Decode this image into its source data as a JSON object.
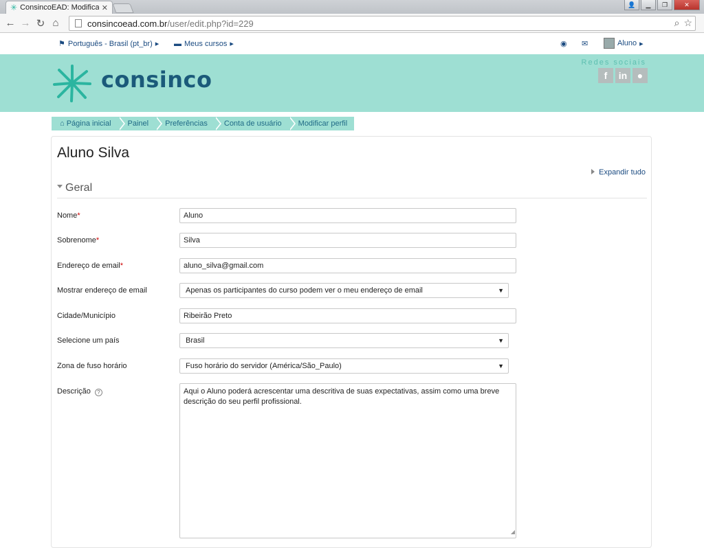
{
  "browser": {
    "tab_title": "ConsincoEAD: Modificar p",
    "tab_close": "✕",
    "url_host": "consincoead.com.br",
    "url_path": "/user/edit.php?id=229"
  },
  "topnav": {
    "language": "Português - Brasil (pt_br)",
    "my_courses": "Meus cursos",
    "user": "Aluno"
  },
  "header": {
    "logo_text": "consinco",
    "social_title": "Redes sociais",
    "social": [
      "f",
      "in",
      "●"
    ]
  },
  "breadcrumb": [
    "Página inicial",
    "Painel",
    "Preferências",
    "Conta de usuário",
    "Modificar perfil"
  ],
  "page": {
    "title": "Aluno Silva",
    "expand_all": "Expandir tudo",
    "section": "Geral"
  },
  "form": {
    "nome_label": "Nome",
    "nome_value": "Aluno",
    "sobrenome_label": "Sobrenome",
    "sobrenome_value": "Silva",
    "email_label": "Endereço de email",
    "email_value": "aluno_silva@gmail.com",
    "show_email_label": "Mostrar endereço de email",
    "show_email_value": "Apenas os participantes do curso podem ver o meu endereço de email",
    "city_label": "Cidade/Município",
    "city_value": "Ribeirão Preto",
    "country_label": "Selecione um país",
    "country_value": "Brasil",
    "timezone_label": "Zona de fuso horário",
    "timezone_value": "Fuso horário do servidor (América/São_Paulo)",
    "description_label": "Descrição",
    "description_value": "Aqui o Aluno poderá acrescentar uma descritiva de suas expectativas, assim como uma breve descrição do seu perfil profissional.",
    "required_mark": "*"
  },
  "colors": {
    "header_bg": "#9edfd3",
    "link": "#1a4a80",
    "logo": "#1b5a7a",
    "logo_mark": "#2bb5a0"
  }
}
